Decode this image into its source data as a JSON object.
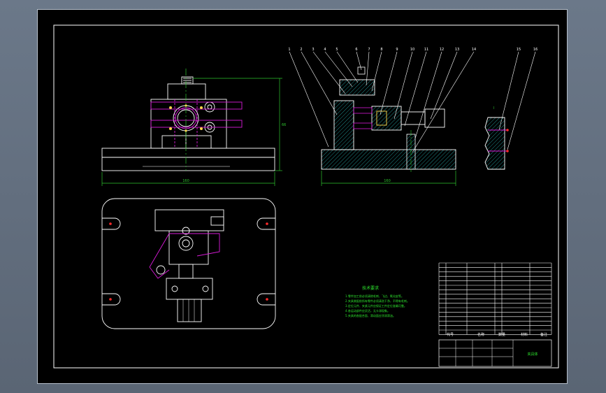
{
  "drawing": {
    "colors": {
      "background": "#000000",
      "line": "#ffffff",
      "hidden": "#d81bd8",
      "dimension": "#2ec52e",
      "hatch": "#1f8a8a",
      "accent": "#ff2a2a",
      "notes": "#2ee62e",
      "part": "#ffd84a"
    },
    "dimensions": {
      "front_height": "66",
      "front_width": "160",
      "section_width": "160"
    },
    "balloons": [
      "1",
      "2",
      "3",
      "4",
      "5",
      "6",
      "7",
      "8",
      "9",
      "10",
      "11",
      "12",
      "13",
      "14",
      "15",
      "16"
    ],
    "notes": {
      "title": "技术要求",
      "lines": [
        "1.零件加工前必须清除毛刺、飞边、氧化皮等。",
        "2.夹具装配前所有零件必须清洗干净，不得有毛刺。",
        "3.定位元件、夹紧元件应保证工件定位准确可靠。",
        "4.各运动部件应灵活，无卡滞现象。",
        "5.夹具的各配合面、滑动面应涂润滑油。"
      ]
    },
    "title_block": {
      "headers": [
        "代号",
        "名称",
        "数量",
        "材料",
        "备注"
      ],
      "drawing_name": "夹具体"
    }
  }
}
